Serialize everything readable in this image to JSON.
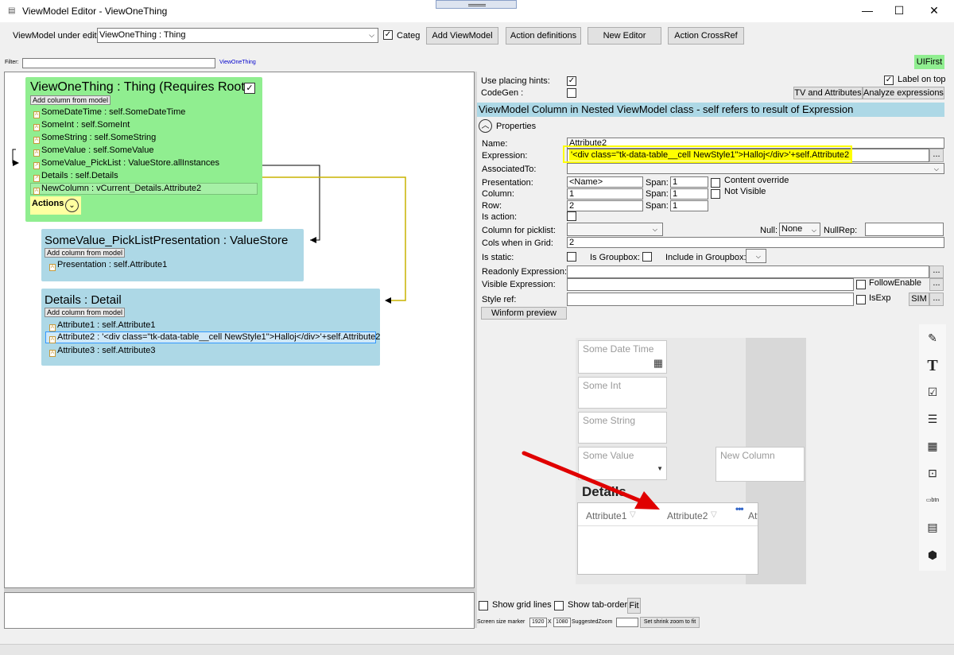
{
  "window": {
    "title": "ViewModel Editor - ViewOneThing",
    "minimize": "—",
    "maximize": "☐",
    "close": "✕"
  },
  "toolbar": {
    "viewmodel_label": "ViewModel under edit:",
    "viewmodel_value": "ViewOneThing : Thing",
    "categ_label": "Categ",
    "categ_checked": "✓",
    "add_viewmodel": "Add ViewModel",
    "action_definitions": "Action definitions",
    "new_editor": "New Editor",
    "action_crossref": "Action CrossRef"
  },
  "filter": {
    "label": "Filter:",
    "value": "",
    "link": "ViewOneThing"
  },
  "uifirst": "UIFirst",
  "diagram": {
    "main": {
      "title": "ViewOneThing : Thing  (Requires Root",
      "root_checked": "✓",
      "add_col": "Add column from model",
      "rows": [
        "SomeDateTime : self.SomeDateTime",
        "SomeInt : self.SomeInt",
        "SomeString : self.SomeString",
        "SomeValue : self.SomeValue",
        "SomeValue_PickList : ValueStore.allInstances",
        "Details : self.Details",
        "NewColumn : vCurrent_Details.Attribute2"
      ],
      "actions": "Actions"
    },
    "picklist": {
      "title": "SomeValue_PickListPresentation : ValueStore",
      "add_col": "Add column from model",
      "rows": [
        "Presentation : self.Attribute1"
      ]
    },
    "details": {
      "title": "Details : Detail",
      "add_col": "Add column from model",
      "rows": [
        "Attribute1 : self.Attribute1",
        "Attribute2 : '<div class=\"tk-data-table__cell NewStyle1\">Halloj</div>'+self.Attribute2",
        "Attribute3 : self.Attribute3"
      ]
    }
  },
  "props": {
    "use_placing_hints": "Use placing hints:",
    "codegen": "CodeGen :",
    "label_on_top": "Label on top",
    "tv_attributes": "TV and Attributes",
    "analyze_expressions": "Analyze expressions",
    "header": "ViewModel Column in Nested ViewModel class - self refers to result of Expression",
    "properties": "Properties",
    "name_label": "Name:",
    "name_value": "Attribute2",
    "expression_label": "Expression:",
    "expression_value": "'<div class=\"tk-data-table__cell NewStyle1\">Halloj</div>'+self.Attribute2",
    "associated_label": "AssociatedTo:",
    "presentation_label": "Presentation:",
    "presentation_value": "<Name>",
    "span": "Span:",
    "span1": "1",
    "span2": "1",
    "span3": "1",
    "content_override": "Content override",
    "not_visible": "Not Visible",
    "column_label": "Column:",
    "column_value": "1",
    "row_label": "Row:",
    "row_value": "2",
    "is_action": "Is action:",
    "column_picklist": "Column for picklist:",
    "null_label": "Null:",
    "null_value": "None",
    "nullrep_label": "NullRep:",
    "cols_grid_label": "Cols when in Grid:",
    "cols_grid_value": "2",
    "is_static": "Is static:",
    "is_groupbox": "Is Groupbox:",
    "include_groupbox": "Include in Groupbox:",
    "readonly_expr": "Readonly Expression:",
    "visible_expr": "Visible Expression:",
    "follow_enable": "FollowEnable",
    "style_ref": "Style ref:",
    "isexp": "IsExp",
    "sim": "SIM",
    "ellipsis": "...",
    "winform_preview": "Winform preview"
  },
  "preview": {
    "some_date_time": "Some Date Time",
    "some_int": "Some Int",
    "some_string": "Some String",
    "some_value": "Some Value",
    "new_column": "New Column",
    "details": "Details",
    "col1": "Attribute1",
    "col2": "Attribute2",
    "col3": "Att",
    "dots": "•••"
  },
  "bottom": {
    "show_grid_lines": "Show grid lines",
    "show_tab_order": "Show tab-order",
    "fit": "Fit",
    "screen_size_marker": "Screen size marker",
    "width": "1920",
    "x": "X",
    "height": "1080",
    "suggested_zoom": "SuggestedZoom",
    "set_shrink_zoom": "Set shrink zoom to fit"
  },
  "colors": {
    "green": "#90ee90",
    "blue": "#add8e6",
    "header": "#add8e6",
    "highlight": "#ffff00",
    "arrow": "#e00000"
  }
}
